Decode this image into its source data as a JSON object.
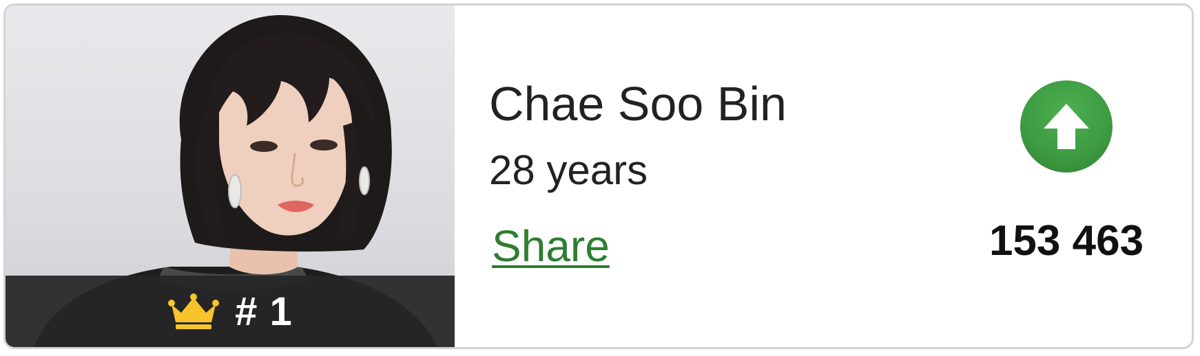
{
  "person": {
    "name": "Chae Soo Bin",
    "age": "28 years",
    "photo_icon": "portrait-photo"
  },
  "rank": {
    "label": "# 1",
    "icon": "crown-icon",
    "icon_color": "#f7c52b"
  },
  "actions": {
    "share_label": "Share",
    "share_color": "#2e7d32",
    "upvote_icon": "arrow-up-icon",
    "upvote_color": "#3d9a41"
  },
  "votes": {
    "count": "153 463"
  }
}
